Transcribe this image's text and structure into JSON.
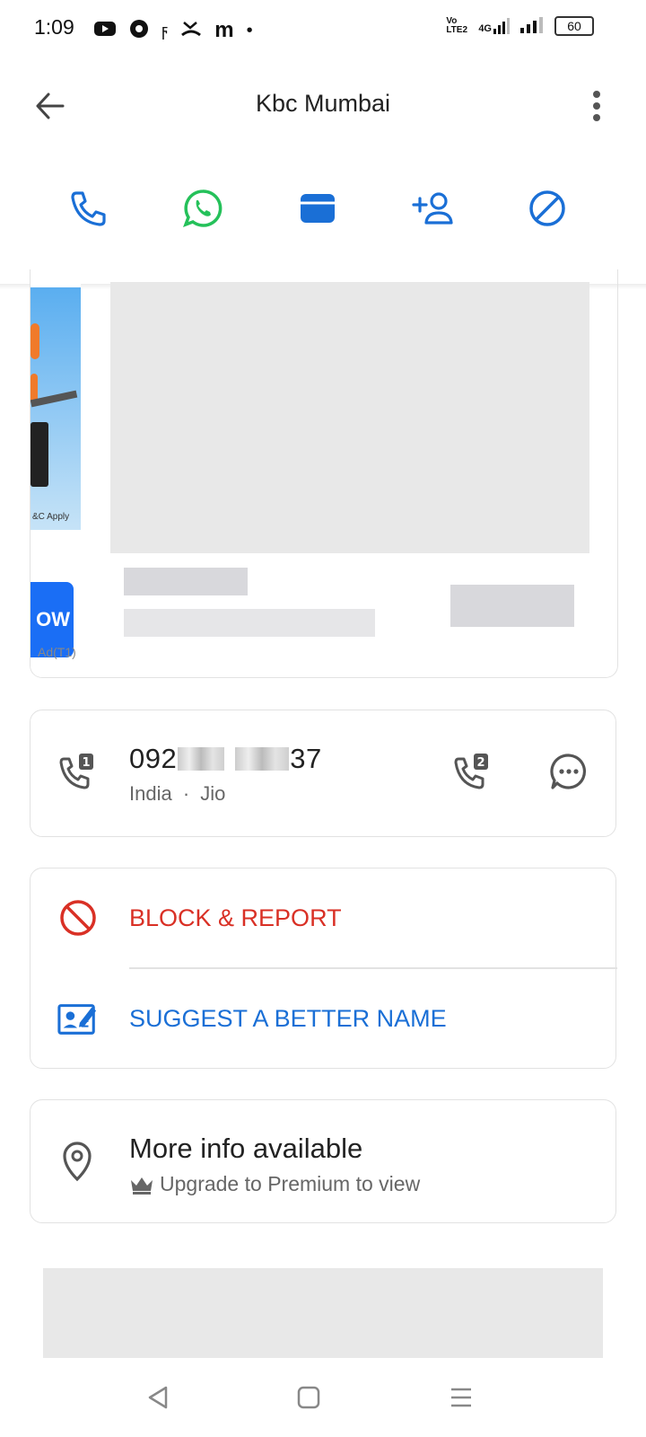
{
  "status_bar": {
    "time": "1:09",
    "volte": "Vo LTE2",
    "network": "4G",
    "battery": "60"
  },
  "header": {
    "title": "Kbc Mumbai"
  },
  "actions": {
    "icons": [
      "phone-icon",
      "whatsapp-icon",
      "message-icon",
      "add-contact-icon",
      "block-icon"
    ],
    "accent": "#1a6fd6",
    "whatsapp_color": "#25c15a"
  },
  "ad": {
    "tc_text": "&C Apply",
    "button_text": "OW",
    "label": "Ad(T1)"
  },
  "phone": {
    "number_prefix": "092",
    "number_suffix": "37",
    "country": "India",
    "separator": "·",
    "carrier": "Jio",
    "sim1": "1",
    "sim2": "2"
  },
  "menu": {
    "block_label": "BLOCK & REPORT",
    "block_color": "#d93025",
    "suggest_label": "SUGGEST A BETTER NAME",
    "suggest_color": "#1a6fd6"
  },
  "info": {
    "title": "More info available",
    "subtitle": "Upgrade to Premium to view"
  }
}
